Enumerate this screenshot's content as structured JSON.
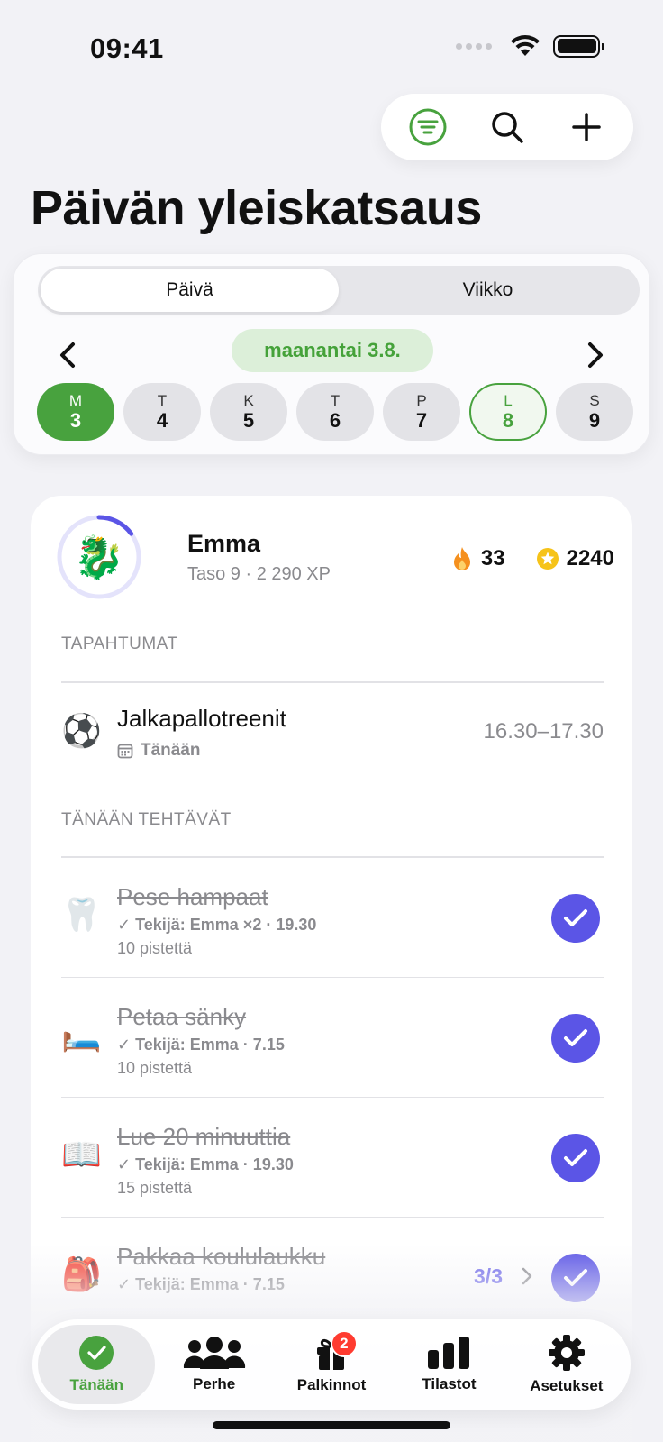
{
  "status_bar": {
    "time": "09:41"
  },
  "page_title": "Päivän yleiskatsaus",
  "segmented": {
    "day": "Päivä",
    "week": "Viikko"
  },
  "date_label": "maanantai 3.8.",
  "days": [
    {
      "letter": "M",
      "num": "3",
      "state": "selected"
    },
    {
      "letter": "T",
      "num": "4",
      "state": ""
    },
    {
      "letter": "K",
      "num": "5",
      "state": ""
    },
    {
      "letter": "T",
      "num": "6",
      "state": ""
    },
    {
      "letter": "P",
      "num": "7",
      "state": ""
    },
    {
      "letter": "L",
      "num": "8",
      "state": "outlined"
    },
    {
      "letter": "S",
      "num": "9",
      "state": ""
    }
  ],
  "profile": {
    "name": "Emma",
    "level": "Taso 9 · 2 290 XP",
    "avatar_emoji": "🐉",
    "level_progress": 0.15,
    "streak": "33",
    "points": "2240"
  },
  "events": {
    "header": "TAPAHTUMAT",
    "items": [
      {
        "emoji": "⚽",
        "title": "Jalkapallotreenit",
        "when": "Tänään",
        "time": "16.30–17.30"
      }
    ]
  },
  "tasks": {
    "header": "TÄNÄÄN TEHTÄVÄT",
    "items": [
      {
        "emoji": "🦷",
        "title": "Pese hampaat",
        "meta": "Tekijä: Emma ×2 · 19.30",
        "points": "10 pistettä",
        "counter": ""
      },
      {
        "emoji": "🛏️",
        "title": "Petaa sänky",
        "meta": "Tekijä: Emma · 7.15",
        "points": "10 pistettä",
        "counter": ""
      },
      {
        "emoji": "📖",
        "title": "Lue 20 minuuttia",
        "meta": "Tekijä: Emma · 19.30",
        "points": "15 pistettä",
        "counter": ""
      },
      {
        "emoji": "🎒",
        "title": "Pakkaa koululaukku",
        "meta": "Tekijä: Emma · 7.15",
        "points": "",
        "counter": "3/3"
      }
    ]
  },
  "tabbar": {
    "today": "Tänään",
    "family": "Perhe",
    "rewards": "Palkinnot",
    "rewards_badge": "2",
    "stats": "Tilastot",
    "settings": "Asetukset"
  },
  "colors": {
    "accent_green": "#48a23e",
    "accent_purple": "#5b55e6",
    "badge_red": "#ff3b30"
  }
}
